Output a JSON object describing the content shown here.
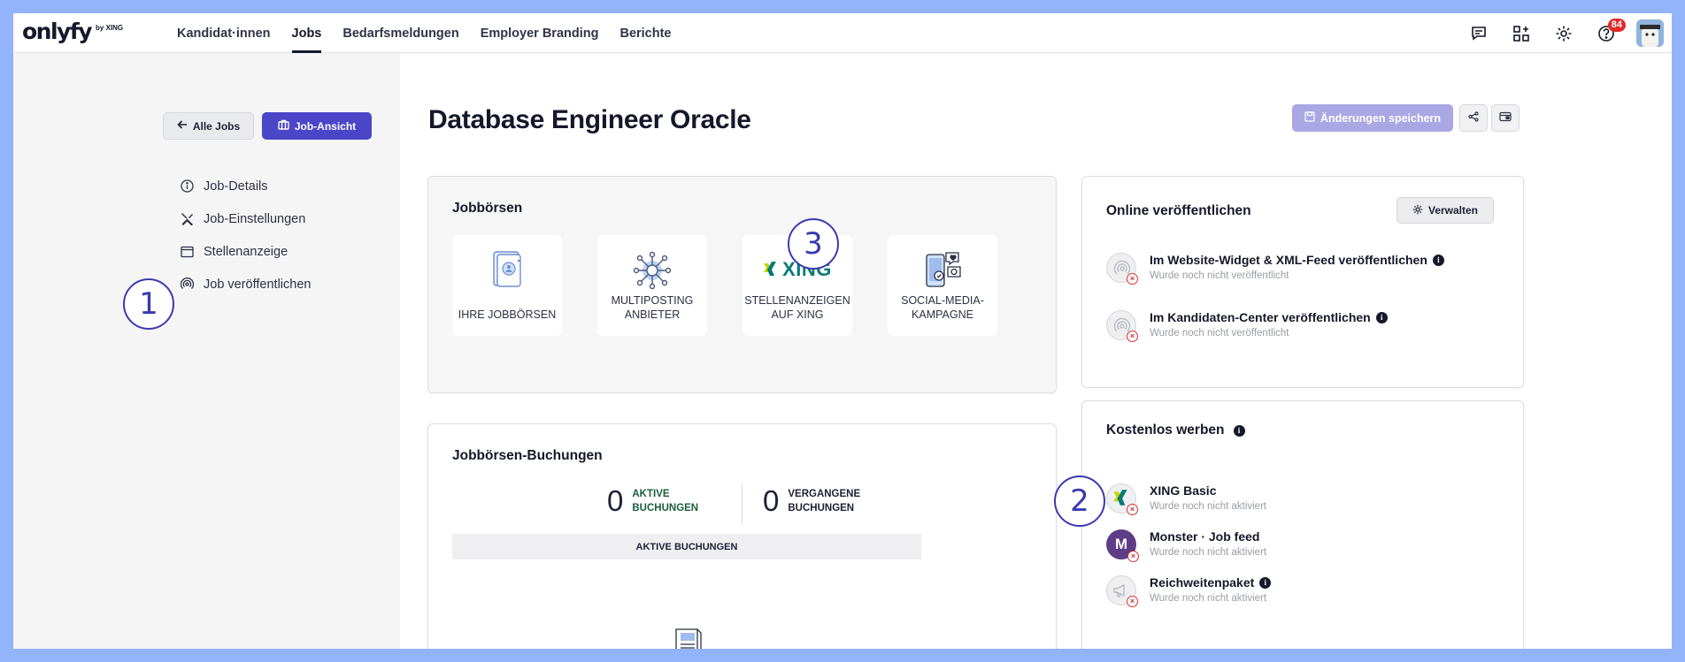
{
  "brand": {
    "logo_text": "onlyfy",
    "logo_suffix": "by XING"
  },
  "nav": {
    "items": [
      "Kandidat·innen",
      "Jobs",
      "Bedarfsmeldungen",
      "Employer Branding",
      "Berichte"
    ],
    "active": "Jobs"
  },
  "topbar": {
    "help_badge": "84",
    "icons": [
      "chat-icon",
      "apps-add-icon",
      "gear-icon",
      "help-icon"
    ]
  },
  "sidebar": {
    "back_label": "Alle Jobs",
    "view_label": "Job-Ansicht",
    "items": [
      {
        "label": "Job-Details",
        "icon": "info-icon"
      },
      {
        "label": "Job-Einstellungen",
        "icon": "tools-icon"
      },
      {
        "label": "Stellenanzeige",
        "icon": "window-icon"
      },
      {
        "label": "Job veröffentlichen",
        "icon": "broadcast-icon"
      }
    ]
  },
  "callouts": [
    "1",
    "2",
    "3"
  ],
  "header": {
    "title": "Database Engineer Oracle",
    "save_label": "Änderungen speichern"
  },
  "jobboards": {
    "title": "Jobbörsen",
    "tiles": [
      {
        "label": "IHRE JOBBÖRSEN",
        "icon": "document-ring-icon"
      },
      {
        "label": "MULTIPOSTING\nANBIETER",
        "icon": "network-icon"
      },
      {
        "label": "STELLENANZEIGEN\nAUF XING",
        "icon": "xing-logo",
        "logo_text": "XING"
      },
      {
        "label": "SOCIAL-MEDIA-\nKAMPAGNE",
        "icon": "social-phone-icon"
      }
    ]
  },
  "bookings": {
    "title": "Jobbörsen-Buchungen",
    "active_count": "0",
    "active_label": "AKTIVE\nBUCHUNGEN",
    "past_count": "0",
    "past_label": "VERGANGENE\nBUCHUNGEN",
    "tab_label": "AKTIVE BUCHUNGEN"
  },
  "publish": {
    "title": "Online veröffentlichen",
    "manage_label": "Verwalten",
    "items": [
      {
        "title": "Im Website-Widget & XML-Feed veröffentlichen",
        "status": "Wurde noch nicht veröffentlicht"
      },
      {
        "title": "Im Kandidaten-Center veröffentlichen",
        "status": "Wurde noch nicht veröffentlicht"
      }
    ]
  },
  "free": {
    "title": "Kostenlos werben",
    "items": [
      {
        "title": "XING Basic",
        "status": "Wurde noch nicht aktiviert",
        "info": false
      },
      {
        "title": "Monster · Job feed",
        "status": "Wurde noch nicht aktiviert",
        "info": false
      },
      {
        "title": "Reichweitenpaket",
        "status": "Wurde noch nicht aktiviert",
        "info": true
      }
    ]
  },
  "colors": {
    "primary": "#4b46c8",
    "primary_disabled": "#aaa7e4",
    "xing_green": "#c6d300",
    "xing_teal": "#0a7a73",
    "error": "#d63333",
    "frame": "#93b3fb",
    "callout": "#3a3ab0"
  }
}
